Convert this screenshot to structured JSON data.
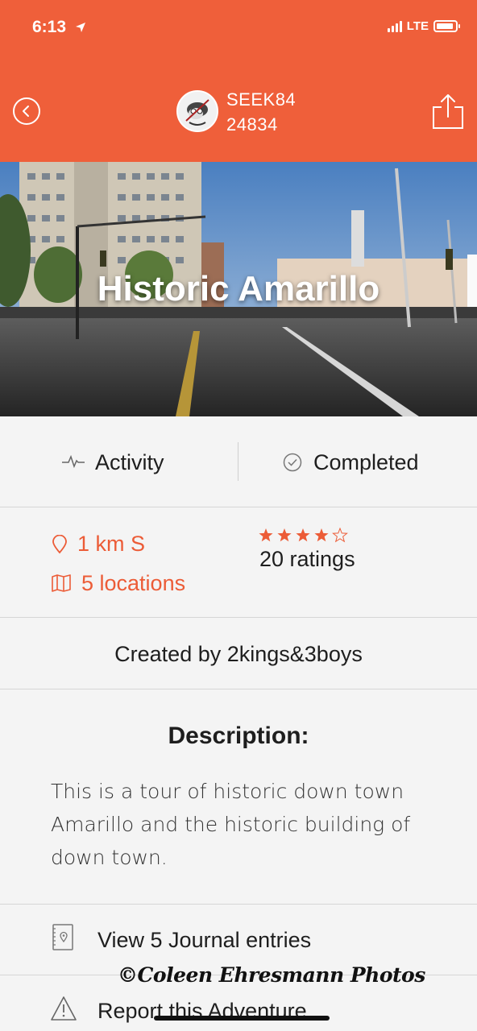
{
  "status_bar": {
    "time": "6:13",
    "network": "LTE"
  },
  "header": {
    "username_line1": "SEEK84",
    "username_line2": "24834"
  },
  "hero": {
    "title": "Historic Amarillo"
  },
  "info_tabs": {
    "activity_label": "Activity",
    "completed_label": "Completed"
  },
  "stats": {
    "distance": "1 km S",
    "locations": "5 locations",
    "rating_stars": 4,
    "rating_max": 5,
    "ratings_text": "20 ratings"
  },
  "creator": {
    "text": "Created by 2kings&3boys"
  },
  "description": {
    "heading": "Description:",
    "body": "This is a tour of historic down town Amarillo and the historic building of down town."
  },
  "actions": {
    "journal": "View 5 Journal entries",
    "report": "Report this Adventure"
  },
  "watermark": "©Coleen Ehresmann Photos",
  "colors": {
    "accent": "#ef5f3a",
    "star": "#ec5c37"
  }
}
